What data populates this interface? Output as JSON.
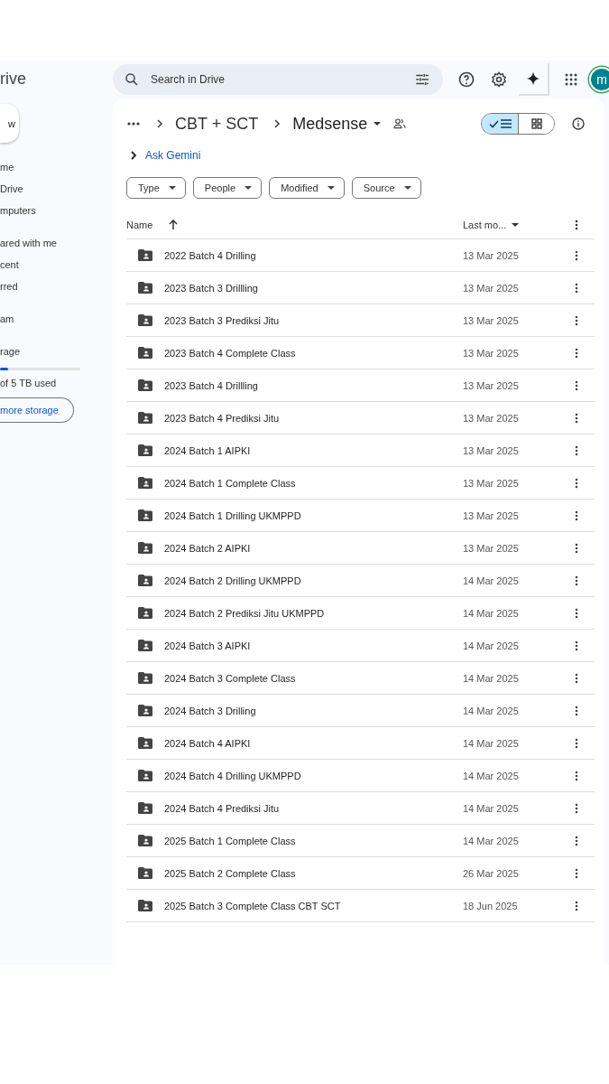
{
  "app": {
    "logo_text": "rive",
    "new_button": "w"
  },
  "sidebar": {
    "groups": [
      [
        "me",
        "Drive",
        "mputers"
      ],
      [
        "ared with me",
        "cent",
        "rred"
      ],
      [
        "am"
      ]
    ],
    "storage": {
      "label": "rage",
      "level": 0.1,
      "used": "of 5 TB used",
      "button": "more storage"
    }
  },
  "search": {
    "placeholder": "Search in Drive"
  },
  "account": {
    "initial": "m"
  },
  "breadcrumb": {
    "parent": "CBT + SCT",
    "current": "Medsense"
  },
  "view_toggle": [
    {
      "kind": "list",
      "selected": true
    },
    {
      "kind": "grid",
      "selected": false
    }
  ],
  "ask": "Ask Gemini",
  "filters": [
    "Type",
    "People",
    "Modified",
    "Source"
  ],
  "table": {
    "columns": [
      "Name",
      "Last mo..."
    ],
    "rows": [
      {
        "name": "2022 Batch 4 Drilling",
        "date": "13 Mar 2025"
      },
      {
        "name": "2023 Batch 3 Drillling",
        "date": "13 Mar 2025"
      },
      {
        "name": "2023 Batch 3 Prediksi Jitu",
        "date": "13 Mar 2025"
      },
      {
        "name": "2023 Batch 4 Complete Class",
        "date": "13 Mar 2025"
      },
      {
        "name": "2023 Batch 4 Drillling",
        "date": "13 Mar 2025"
      },
      {
        "name": "2023 Batch 4 Prediksi Jitu",
        "date": "13 Mar 2025"
      },
      {
        "name": "2024 Batch 1 AIPKI",
        "date": "13 Mar 2025"
      },
      {
        "name": "2024 Batch 1 Complete Class",
        "date": "13 Mar 2025"
      },
      {
        "name": "2024 Batch 1 Drilling UKMPPD",
        "date": "13 Mar 2025"
      },
      {
        "name": "2024 Batch 2 AIPKI",
        "date": "13 Mar 2025"
      },
      {
        "name": "2024 Batch 2 Drilling UKMPPD",
        "date": "14 Mar 2025"
      },
      {
        "name": "2024 Batch 2 Prediksi Jitu UKMPPD",
        "date": "14 Mar 2025"
      },
      {
        "name": "2024 Batch 3 AIPKI",
        "date": "14 Mar 2025"
      },
      {
        "name": "2024 Batch 3 Complete Class",
        "date": "14 Mar 2025"
      },
      {
        "name": "2024 Batch 3 Drilling",
        "date": "14 Mar 2025"
      },
      {
        "name": "2024 Batch 4 AIPKI",
        "date": "14 Mar 2025"
      },
      {
        "name": "2024 Batch 4 Drilling UKMPPD",
        "date": "14 Mar 2025"
      },
      {
        "name": "2024 Batch 4 Prediksi Jitu",
        "date": "14 Mar 2025"
      },
      {
        "name": "2025 Batch 1 Complete Class",
        "date": "14 Mar 2025"
      },
      {
        "name": "2025 Batch 2 Complete Class",
        "date": "26 Mar 2025"
      },
      {
        "name": "2025 Batch 3 Complete Class CBT SCT",
        "date": "18 Jun 2025"
      }
    ]
  }
}
